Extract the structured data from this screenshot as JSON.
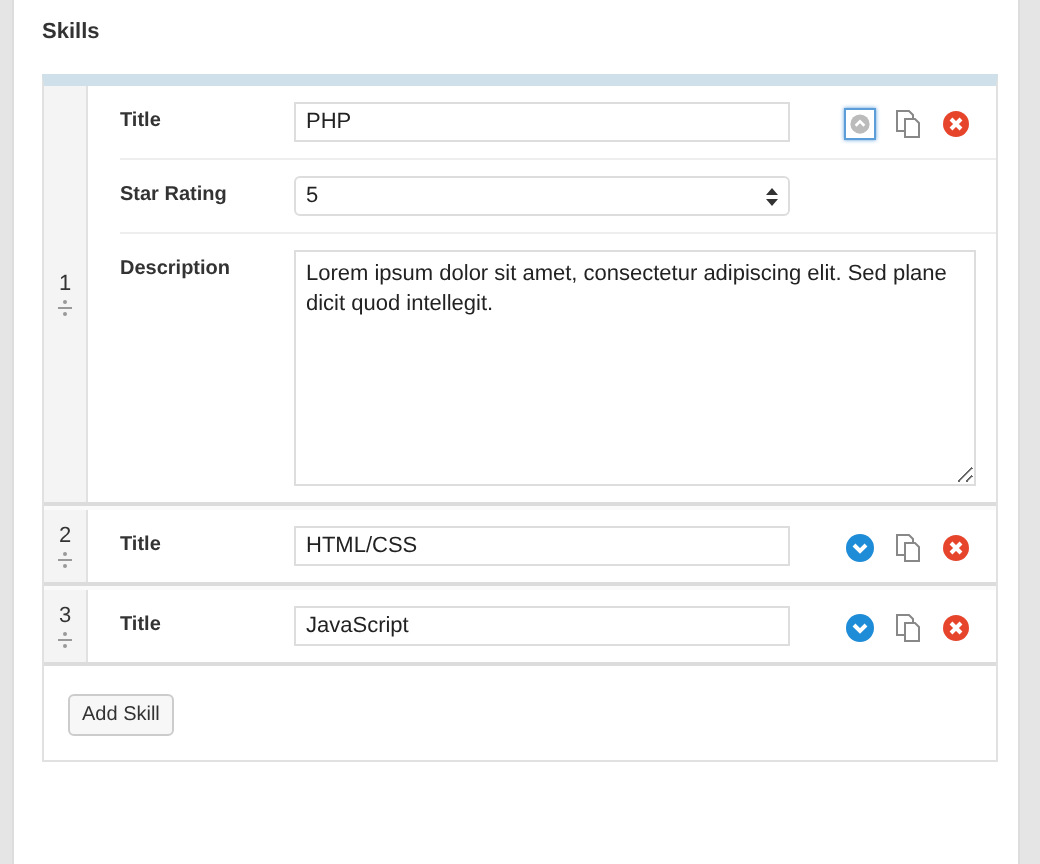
{
  "section_title": "Skills",
  "skills": [
    {
      "index": "1",
      "expanded": true,
      "fields": [
        {
          "kind": "text",
          "label": "Title",
          "value": "PHP"
        },
        {
          "kind": "select",
          "label": "Star Rating",
          "value": "5"
        },
        {
          "kind": "textarea",
          "label": "Description",
          "value": "Lorem ipsum dolor sit amet, consectetur adipiscing elit. Sed plane dicit quod intellegit."
        }
      ]
    },
    {
      "index": "2",
      "expanded": false,
      "fields": [
        {
          "kind": "text",
          "label": "Title",
          "value": "HTML/CSS"
        }
      ]
    },
    {
      "index": "3",
      "expanded": false,
      "fields": [
        {
          "kind": "text",
          "label": "Title",
          "value": "JavaScript"
        }
      ]
    }
  ],
  "add_button": "Add Skill"
}
